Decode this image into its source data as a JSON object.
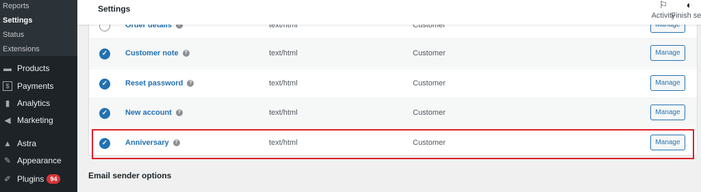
{
  "sidebar": {
    "submenu": [
      {
        "label": "Reports",
        "current": false
      },
      {
        "label": "Settings",
        "current": true
      },
      {
        "label": "Status",
        "current": false
      },
      {
        "label": "Extensions",
        "current": false
      }
    ],
    "menu": [
      {
        "label": "Products",
        "icon": "products-icon",
        "glyph": "▬"
      },
      {
        "label": "Payments",
        "icon": "payments-icon",
        "glyph": "$"
      },
      {
        "label": "Analytics",
        "icon": "analytics-icon",
        "glyph": "▮"
      },
      {
        "label": "Marketing",
        "icon": "marketing-icon",
        "glyph": "◀"
      },
      {
        "label": "Astra",
        "icon": "astra-icon",
        "glyph": "▲"
      },
      {
        "label": "Appearance",
        "icon": "appearance-icon",
        "glyph": "✎"
      },
      {
        "label": "Plugins",
        "icon": "plugins-icon",
        "glyph": "✐",
        "badge": "94"
      }
    ]
  },
  "header": {
    "title": "Settings",
    "activity_label": "Activity",
    "finish_label": "Finish setu"
  },
  "emails": {
    "partial_row": {
      "name": "Order details",
      "content_type": "text/html",
      "recipient": "Customer",
      "action": "Manage"
    },
    "rows": [
      {
        "name": "Customer note",
        "content_type": "text/html",
        "recipient": "Customer",
        "action": "Manage"
      },
      {
        "name": "Reset password",
        "content_type": "text/html",
        "recipient": "Customer",
        "action": "Manage"
      },
      {
        "name": "New account",
        "content_type": "text/html",
        "recipient": "Customer",
        "action": "Manage"
      },
      {
        "name": "Anniversary",
        "content_type": "text/html",
        "recipient": "Customer",
        "action": "Manage"
      }
    ]
  },
  "section": {
    "heading": "Email sender options"
  },
  "colors": {
    "accent": "#2271b1",
    "sidebar_bg": "#1d2327",
    "highlight": "#e01b24",
    "badge": "#d63638"
  }
}
